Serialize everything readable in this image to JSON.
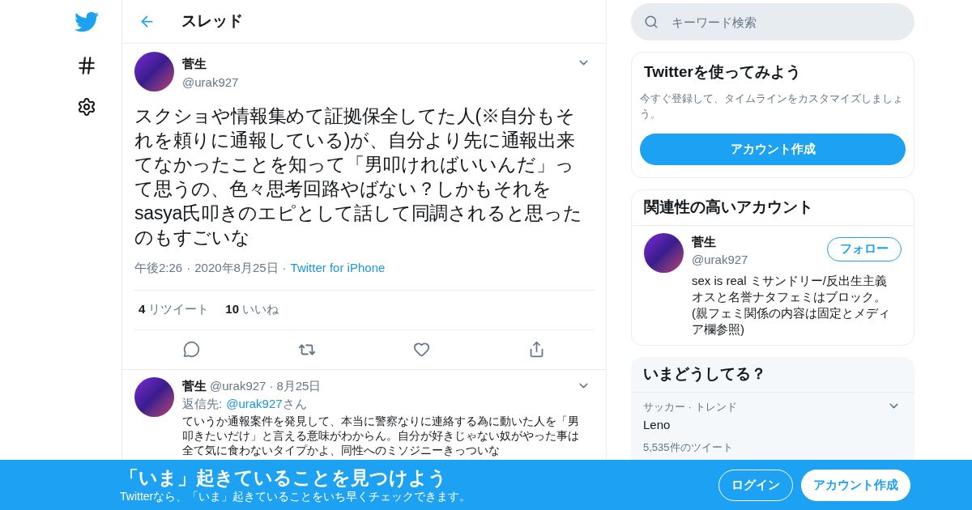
{
  "header": {
    "title": "スレッド"
  },
  "search": {
    "placeholder": "キーワード検索"
  },
  "tweet": {
    "name": "菅生",
    "handle": "@urak927",
    "text": "スクショや情報集めて証拠保全してた人(※自分もそれを頼りに通報している)が、自分より先に通報出来てなかったことを知って「男叩ければいいんだ」って思うの、色々思考回路やばない？しかもそれをsasya氏叩きのエピとして話して同調されると思ったのもすごいな",
    "time": "午後2:26",
    "separator": "·",
    "date": "2020年8月25日",
    "source": "Twitter for iPhone",
    "stats": [
      {
        "count": "4",
        "label": "リツイート"
      },
      {
        "count": "10",
        "label": "いいね"
      }
    ]
  },
  "reply": {
    "name": "菅生",
    "handle": "@urak927",
    "date": "8月25日",
    "separator": "·",
    "reply_prefix": "返信先:",
    "reply_to": "@urak927",
    "reply_suffix": "さん",
    "text": "ていうか通報案件を発見して、本当に警察なりに連絡する為に動いた人を「男叩きたいだけ」と言える意味がわからん。自分が好きじゃない奴がやった事は全て気に食わないタイプかよ、同性へのミソジニーきっついな"
  },
  "signup": {
    "title": "Twitterを使ってみよう",
    "text": "今すぐ登録して、タイムラインをカスタマイズしましょう。",
    "button": "アカウント作成"
  },
  "related": {
    "title": "関連性の高いアカウント",
    "name": "菅生",
    "handle": "@urak927",
    "button": "フォロー",
    "bio": "sex is real ミサンドリー/反出生主義オスと名誉ナタフェミはブロック。(親フェミ関係の内容は固定とメディア欄参照)"
  },
  "trends": {
    "title": "いまどうしてる？",
    "items": [
      {
        "context": "サッカー · トレンド",
        "name": "Leno",
        "count": "5,535件のツイート"
      }
    ]
  },
  "banner": {
    "title": "「いま」起きていることを見つけよう",
    "text": "Twitterなら、「いま」起きていることをいち早くチェックできます。",
    "buttons": [
      {
        "kind": "outline",
        "label": "ログイン"
      },
      {
        "kind": "filled",
        "label": "アカウント作成"
      }
    ]
  }
}
